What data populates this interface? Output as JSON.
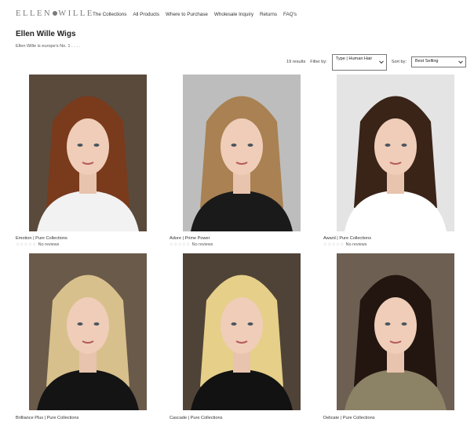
{
  "header": {
    "logo_text_left": "ELLEN",
    "logo_text_right": "WILLE",
    "nav": [
      "The Collections",
      "All Products",
      "Where to Purchase",
      "Wholesale Inquiry",
      "Returns",
      "FAQ's"
    ]
  },
  "page": {
    "title": "Ellen Wille Wigs",
    "description": "Ellen Wille is europe's No. 1 . . . ."
  },
  "toolbar": {
    "results": "19 results",
    "filter_label": "Filter by:",
    "filter_value": "Type | Human Hair",
    "sort_label": "Sort by:",
    "sort_value": "Best Selling"
  },
  "products": [
    {
      "title": "Emotion | Pure Collections",
      "stars": "☆☆☆☆☆",
      "reviews": "No reviews",
      "hair_color": "#7a3a1c",
      "bg": "#5a4a3c",
      "top_color": "#f2f2f2"
    },
    {
      "title": "Adore | Prime Power",
      "stars": "☆☆☆☆☆",
      "reviews": "No reviews",
      "hair_color": "#a98152",
      "bg": "#bdbdbd",
      "top_color": "#1a1a1a"
    },
    {
      "title": "Award | Pure Collections",
      "stars": "☆☆☆☆☆",
      "reviews": "No reviews",
      "hair_color": "#3a2418",
      "bg": "#e4e4e4",
      "top_color": "#ffffff"
    },
    {
      "title": "Brilliance Plus | Pure Collections",
      "hair_color": "#d8c08c",
      "bg": "#6a5a4a",
      "top_color": "#141414"
    },
    {
      "title": "Cascade | Pure Collections",
      "hair_color": "#e6cf88",
      "bg": "#4f4338",
      "top_color": "#121212"
    },
    {
      "title": "Delicate | Pure Collections",
      "hair_color": "#231610",
      "bg": "#6d5f52",
      "top_color": "#8c8266"
    }
  ]
}
